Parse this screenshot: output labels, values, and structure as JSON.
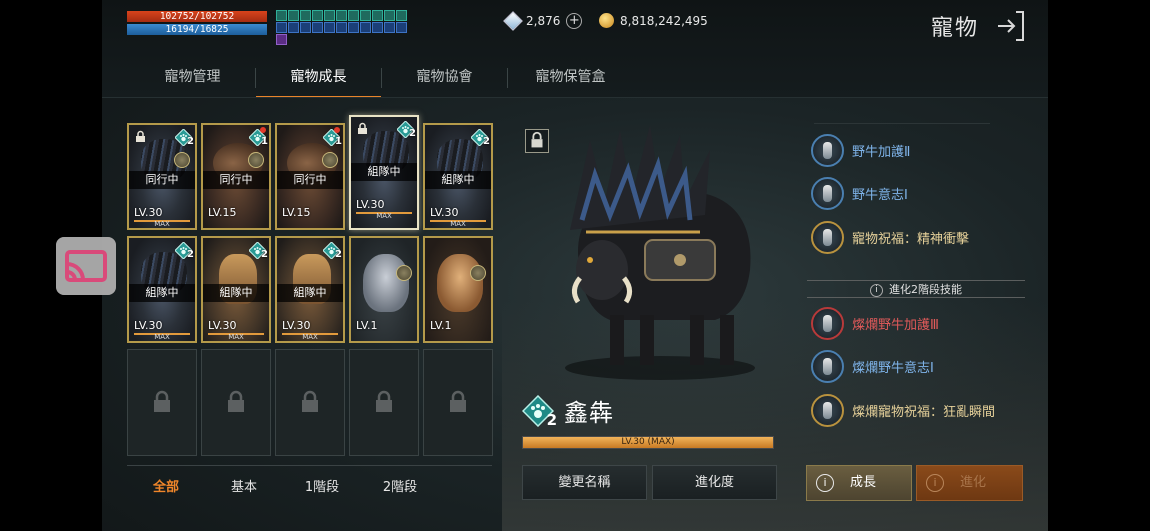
{
  "player": {
    "hp": "102752/102752",
    "mp": "16194/16825"
  },
  "currency": {
    "diamonds": "2,876",
    "gold": "8,818,242,495"
  },
  "header": {
    "title": "寵物"
  },
  "tabs": [
    {
      "label": "寵物管理",
      "active": false
    },
    {
      "label": "寵物成長",
      "active": true
    },
    {
      "label": "寵物協會",
      "active": false
    },
    {
      "label": "寵物保管盒",
      "active": false
    }
  ],
  "pets": [
    {
      "art": "bison",
      "status": "同行中",
      "level": "LV.30",
      "max": "MAX",
      "rank": "2",
      "locked": true,
      "gear": true
    },
    {
      "art": "boar",
      "status": "同行中",
      "level": "LV.15",
      "max": "",
      "rank": "1",
      "locked": false,
      "gear": true,
      "dot": true
    },
    {
      "art": "boar",
      "status": "同行中",
      "level": "LV.15",
      "max": "",
      "rank": "1",
      "locked": false,
      "gear": true,
      "dot": true
    },
    {
      "art": "bison",
      "status": "組隊中",
      "level": "LV.30",
      "max": "MAX",
      "rank": "2",
      "locked": true,
      "gear": false,
      "selected": true
    },
    {
      "art": "bison",
      "status": "組隊中",
      "level": "LV.30",
      "max": "MAX",
      "rank": "2",
      "locked": false,
      "gear": false
    },
    {
      "art": "bison",
      "status": "組隊中",
      "level": "LV.30",
      "max": "MAX",
      "rank": "2",
      "locked": false,
      "gear": false
    },
    {
      "art": "fox",
      "status": "組隊中",
      "level": "LV.30",
      "max": "MAX",
      "rank": "2",
      "locked": false,
      "gear": false
    },
    {
      "art": "fox",
      "status": "組隊中",
      "level": "LV.30",
      "max": "MAX",
      "rank": "2",
      "locked": false,
      "gear": false
    },
    {
      "art": "wolf",
      "status": "",
      "level": "LV.1",
      "max": "",
      "rank": "",
      "locked": false,
      "gear": true
    },
    {
      "art": "cat",
      "status": "",
      "level": "LV.1",
      "max": "",
      "rank": "",
      "locked": false,
      "gear": true
    }
  ],
  "empty_slots": 5,
  "filters": [
    {
      "label": "全部",
      "active": true
    },
    {
      "label": "基本",
      "active": false
    },
    {
      "label": "1階段",
      "active": false
    },
    {
      "label": "2階段",
      "active": false
    }
  ],
  "selected_pet": {
    "name": "鑫犇",
    "rank": "2",
    "level_label": "LV.30 (MAX)",
    "level_progress": 1.0
  },
  "actions": {
    "rename": "變更名稱",
    "evolution_level": "進化度",
    "grow": "成長",
    "evolve": "進化"
  },
  "skills": [
    {
      "label": "野牛加護Ⅱ",
      "tier": "blue"
    },
    {
      "label": "野牛意志Ⅰ",
      "tier": "blue"
    },
    {
      "label": "寵物祝福：精神衝擊",
      "tier": "gold"
    }
  ],
  "evo_header": "進化2階段技能",
  "evo_skills": [
    {
      "label": "燦爛野牛加護Ⅲ",
      "tier": "red"
    },
    {
      "label": "燦爛野牛意志Ⅰ",
      "tier": "blue"
    },
    {
      "label": "燦爛寵物祝福：狂亂瞬間",
      "tier": "gold"
    }
  ],
  "colors": {
    "accent": "#e9842a",
    "skill_blue": "#7fb4ea",
    "skill_gold": "#e6d19a",
    "skill_red": "#e05a5a"
  }
}
